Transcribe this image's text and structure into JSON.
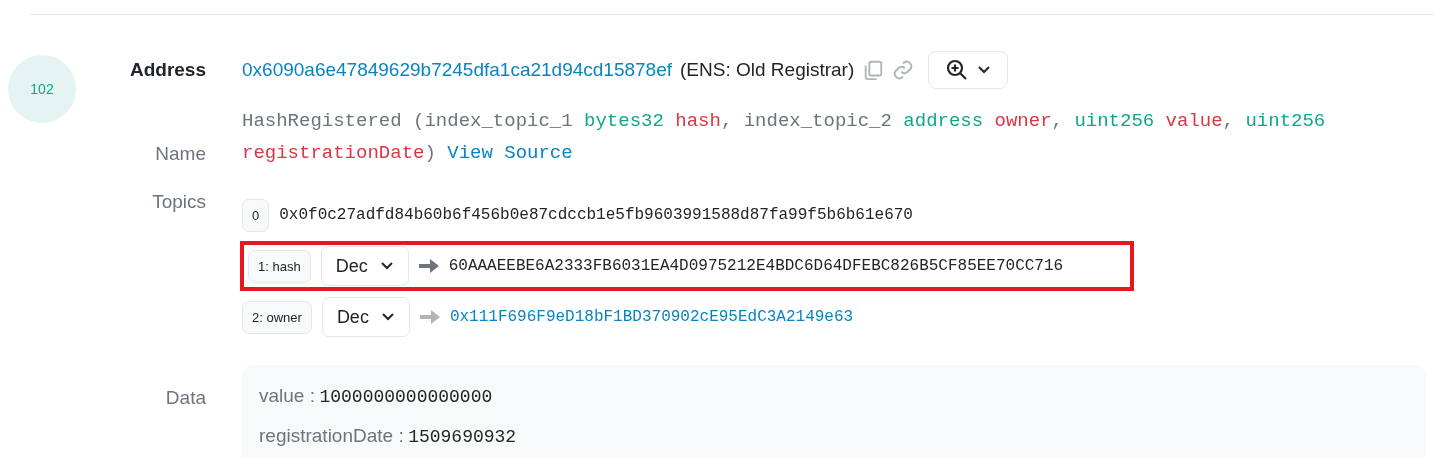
{
  "log_index": "102",
  "address": {
    "label": "Address",
    "value": "0x6090a6e47849629b7245dfa1ca21d94cd15878ef",
    "ens": "(ENS: Old Registrar)"
  },
  "name": {
    "label": "Name",
    "segments": [
      {
        "kind": "plain",
        "text": "HashRegistered (index_topic_1 "
      },
      {
        "kind": "type",
        "text": "bytes32 "
      },
      {
        "kind": "param",
        "text": "hash"
      },
      {
        "kind": "plain",
        "text": ", index_topic_2 "
      },
      {
        "kind": "type",
        "text": "address "
      },
      {
        "kind": "param",
        "text": "owner"
      },
      {
        "kind": "plain",
        "text": ", "
      },
      {
        "kind": "type",
        "text": "uint256 "
      },
      {
        "kind": "param",
        "text": "value"
      },
      {
        "kind": "plain",
        "text": ", "
      },
      {
        "kind": "type",
        "text": "uint256 "
      },
      {
        "kind": "param",
        "text": "registrationDate"
      },
      {
        "kind": "plain",
        "text": ")"
      }
    ],
    "link": "View Source"
  },
  "topics": {
    "label": "Topics",
    "items": [
      {
        "index": "0",
        "kind": "raw",
        "value": "0x0f0c27adfd84b60b6f456b0e87cdccb1e5fb9603991588d87fa99f5b6b61e670",
        "link": false,
        "highlighted": false
      },
      {
        "index": "1: hash",
        "kind": "decoded",
        "format": "Dec",
        "value": "60AAAEEBE6A2333FB6031EA4D0975212E4BDC6D64DFEBC826B5CF85EE70CC716",
        "link": false,
        "highlighted": true
      },
      {
        "index": "2: owner",
        "kind": "decoded",
        "format": "Dec",
        "value": "0x111F696F9eD18bF1BD370902cE95EdC3A2149e63",
        "link": true,
        "highlighted": false
      }
    ]
  },
  "data": {
    "label": "Data",
    "fields": [
      {
        "name": "value :",
        "value": "1000000000000000"
      },
      {
        "name": "registrationDate :",
        "value": "1509690932"
      }
    ]
  }
}
